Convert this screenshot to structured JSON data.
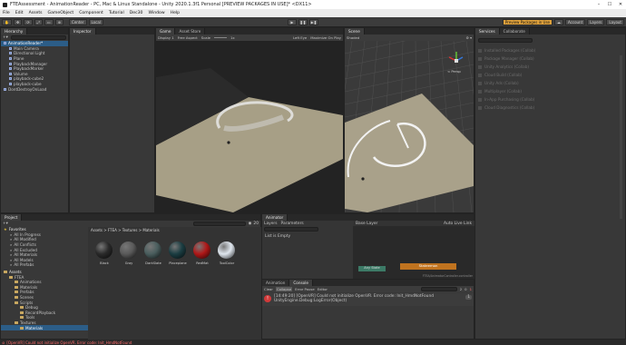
{
  "window": {
    "title": "FTEAssessment - AnimationReader - PC, Mac & Linux Standalone - Unity 2020.1.3f1 Personal [PREVIEW PACKAGES IN USE]* <DX11>"
  },
  "menu": [
    "File",
    "Edit",
    "Assets",
    "GameObject",
    "Component",
    "Tutorial",
    "Dec30",
    "Window",
    "Help"
  ],
  "toolbar": {
    "left_buttons": [
      "Center",
      "Local"
    ],
    "preview_badge": "Preview Packages in Use",
    "account": "Account",
    "layers": "Layers",
    "layout": "Layout"
  },
  "hierarchy": {
    "tab": "Hierarchy",
    "items": [
      {
        "label": "AnimationReader*",
        "indent": 0,
        "selected": true
      },
      {
        "label": "Main Camera",
        "indent": 1
      },
      {
        "label": "Directional Light",
        "indent": 1
      },
      {
        "label": "Plane",
        "indent": 1
      },
      {
        "label": "PlaybackManager",
        "indent": 1
      },
      {
        "label": "PlaybackMarker",
        "indent": 1
      },
      {
        "label": "Volume",
        "indent": 1
      },
      {
        "label": "playback-cube2",
        "indent": 1
      },
      {
        "label": "playback-cube",
        "indent": 1
      },
      {
        "label": "DontDestroyOnLoad",
        "indent": 0
      }
    ]
  },
  "inspector": {
    "tab": "Inspector"
  },
  "game": {
    "tabs": [
      "Game",
      "Asset Store"
    ],
    "display": "Display 1",
    "aspect": "Free Aspect",
    "scale_label": "Scale",
    "scale_value": "1x",
    "right_options": [
      "Left Eye",
      "Maximize On Play"
    ]
  },
  "scene": {
    "tab": "Scene",
    "shading": "Shaded",
    "persp": "< Persp"
  },
  "services": {
    "tabs": [
      "Services",
      "Collaborate"
    ],
    "rows": [
      "Installed Packages (Collab)",
      "Package Manager (Collab)",
      "Unity Analytics (Collab)",
      "Cloud Build (Collab)",
      "Unity Ads (Collab)",
      "Multiplayer (Collab)",
      "In-App Purchasing (Collab)",
      "Cloud Diagnostics (Collab)"
    ]
  },
  "project": {
    "tab": "Project",
    "count": "20",
    "favorites_label": "Favorites",
    "favorites": [
      "All In Progress",
      "All Modified",
      "All Conflicts",
      "All Excluded",
      "All Materials",
      "All Models",
      "All Prefabs"
    ],
    "assets_label": "Assets",
    "tree": [
      "FTEA",
      "Animations",
      "Materials",
      "Prefabs",
      "Scenes",
      "Scripts",
      "Debug",
      "RecordPlayback",
      "Tools",
      "Textures",
      "Materials"
    ],
    "breadcrumb": "Assets > FTEA > Textures > Materials",
    "materials": [
      {
        "name": "Black",
        "color": "#2a2a2a"
      },
      {
        "name": "Gray",
        "color": "#5a5a5a"
      },
      {
        "name": "DarkSlate",
        "color": "#4a5e5e"
      },
      {
        "name": "Placeplane",
        "color": "#1b3d42"
      },
      {
        "name": "RedMat",
        "color": "#b01818"
      },
      {
        "name": "ToolColor",
        "color": "#dfe6ee"
      }
    ]
  },
  "animator": {
    "tab": "Animator",
    "subtabs": [
      "Layers",
      "Parameters"
    ],
    "base_layer": "Base Layer",
    "autolive": "Auto Live Link",
    "list_empty": "List is Empty",
    "state_orange": "Stateemon",
    "state_green": "Any State",
    "footer": "FTEA/AnimatorController.controller"
  },
  "console": {
    "tabs": [
      "Animation",
      "Console"
    ],
    "buttons": [
      "Clear",
      "Collapse",
      "Error Pause",
      "Editor"
    ],
    "counts": [
      "2",
      "0",
      "1"
    ],
    "message_line1": "[14:49:20] [OpenVR] Could not initialize OpenVR. Error code: Init_HmdNotFound",
    "message_line2": "UnityEngine.Debug:LogError(Object)",
    "badge": "1"
  },
  "status": {
    "text": "[OpenVR] Could not initialize OpenVR. Error code: Init_HmdNotFound"
  }
}
